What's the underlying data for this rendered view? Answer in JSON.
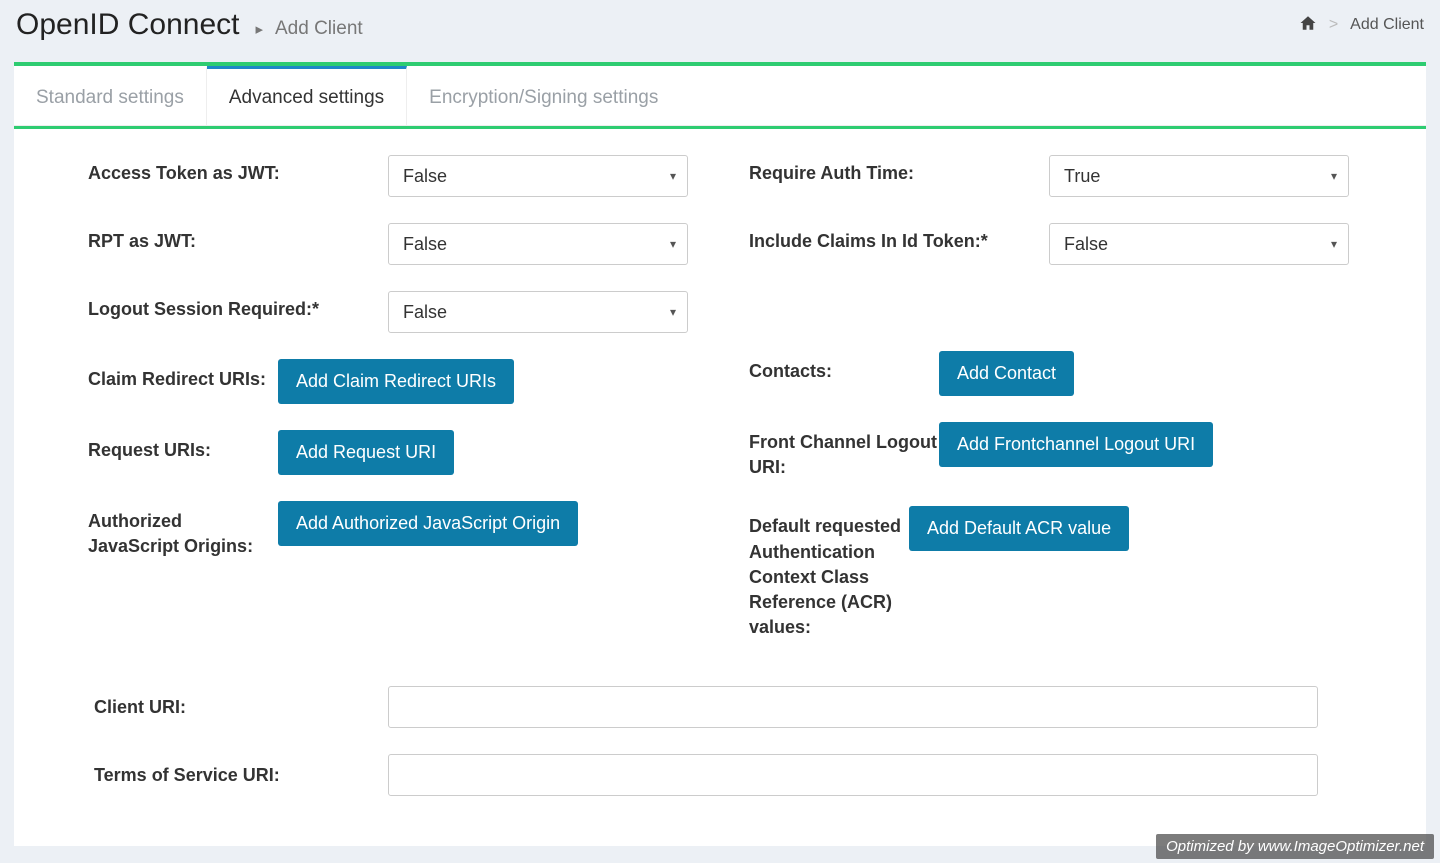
{
  "header": {
    "title": "OpenID Connect",
    "subtitle": "Add Client"
  },
  "breadcrumb": {
    "home": "Home",
    "current": "Add Client"
  },
  "tabs": {
    "standard": "Standard settings",
    "advanced": "Advanced settings",
    "encryption": "Encryption/Signing settings"
  },
  "left": {
    "access_token_jwt": {
      "label": "Access Token as JWT:",
      "value": "False"
    },
    "rpt_jwt": {
      "label": "RPT as JWT:",
      "value": "False"
    },
    "logout_session": {
      "label": "Logout Session Required:*",
      "value": "False"
    },
    "claim_redirect": {
      "label": "Claim Redirect URIs:",
      "button": "Add Claim Redirect URIs"
    },
    "request_uris": {
      "label": "Request URIs:",
      "button": "Add Request URI"
    },
    "authorized_js": {
      "label": "Authorized JavaScript Origins:",
      "button": "Add Authorized JavaScript Origin"
    }
  },
  "right": {
    "require_auth_time": {
      "label": "Require Auth Time:",
      "value": "True"
    },
    "include_claims": {
      "label": "Include Claims In Id Token:*",
      "value": "False"
    },
    "contacts": {
      "label": "Contacts:",
      "button": "Add Contact"
    },
    "front_channel": {
      "label": "Front Channel Logout URI:",
      "button": "Add Frontchannel Logout URI"
    },
    "default_acr": {
      "label": "Default requested Authentication Context Class Reference (ACR) values:",
      "button": "Add Default ACR value"
    }
  },
  "bottom": {
    "client_uri": {
      "label": "Client URI:",
      "value": ""
    },
    "tos_uri": {
      "label": "Terms of Service URI:",
      "value": ""
    }
  },
  "watermark": "Optimized by www.ImageOptimizer.net"
}
